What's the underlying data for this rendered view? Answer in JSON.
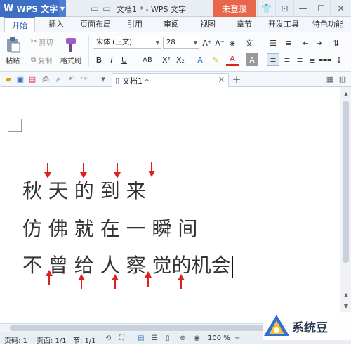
{
  "titlebar": {
    "app_label": "WPS 文字",
    "doc_title": "文档1 * - WPS 文字",
    "login_label": "未登录"
  },
  "tabs": [
    "开始",
    "插入",
    "页面布局",
    "引用",
    "审阅",
    "视图",
    "章节",
    "开发工具",
    "特色功能"
  ],
  "active_tab": "开始",
  "ribbon": {
    "paste_label": "粘贴",
    "cut_label": "剪切",
    "copy_label": "复制",
    "format_painter_label": "格式刷",
    "font_name": "宋体 (正文)",
    "font_size": "28",
    "bold": "B",
    "italic": "I",
    "underline": "U",
    "strike": "AB",
    "superscript": "X²",
    "subscript": "X₂",
    "font_color_label": "A",
    "clear_label": "A"
  },
  "doc_tab": {
    "label": "文档1 *"
  },
  "document": {
    "lines": [
      "秋 天 的 到 来",
      "仿 佛 就 在 一 瞬 间",
      "不 曾 给 人 察 觉的机会"
    ]
  },
  "status": {
    "page": "页码: 1",
    "pages": "页面: 1/1",
    "section": "节: 1/1",
    "zoom": "100 %"
  },
  "watermark": {
    "text": "系统豆"
  },
  "colors": {
    "accent": "#3d6fc4",
    "login": "#e8674a",
    "arrow": "#e02020"
  }
}
